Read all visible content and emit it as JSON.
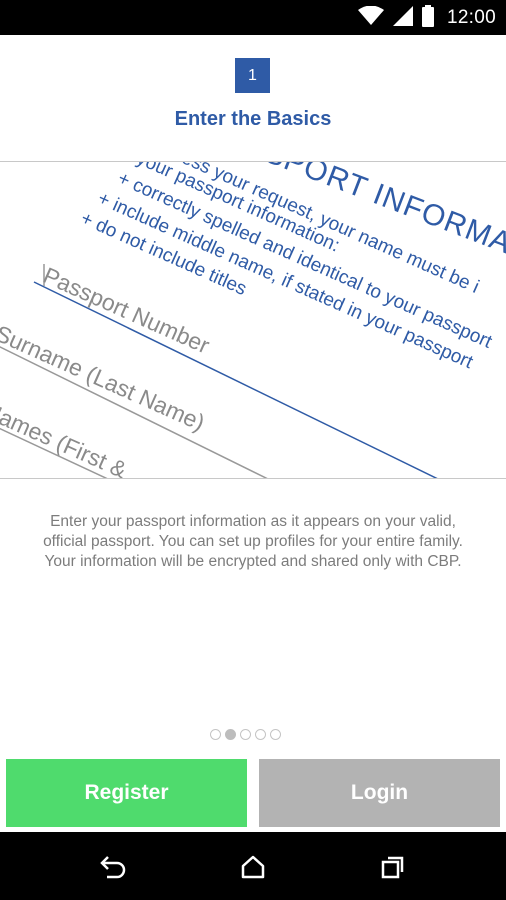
{
  "status_bar": {
    "time": "12:00",
    "icons": [
      "wifi-icon",
      "cell-signal-icon",
      "battery-icon"
    ]
  },
  "step": {
    "number": "1",
    "title": "Enter the Basics"
  },
  "hero_image": {
    "heading": "PASSPORT INFORMATION",
    "instructions": [
      "To process your request, your name must be i",
      "your passport information:",
      "+ correctly spelled and identical to your passport",
      "+ include middle name, if stated in your passport",
      "+ do not include titles"
    ],
    "fields": [
      "Passport Number",
      "Surname (Last Name)",
      "Given Names (First &"
    ]
  },
  "description": "Enter your passport information as it appears on your valid, official passport. You can set up profiles for your entire family. Your information will be encrypted and shared only with CBP.",
  "pager": {
    "total": 5,
    "active_index": 1
  },
  "buttons": {
    "register": "Register",
    "login": "Login"
  },
  "nav_bar": {
    "icons": [
      "back-icon",
      "home-icon",
      "recents-icon"
    ]
  },
  "colors": {
    "brand_blue": "#2f5ba6",
    "register_green": "#4fdb6d",
    "login_gray": "#b3b3b3"
  }
}
